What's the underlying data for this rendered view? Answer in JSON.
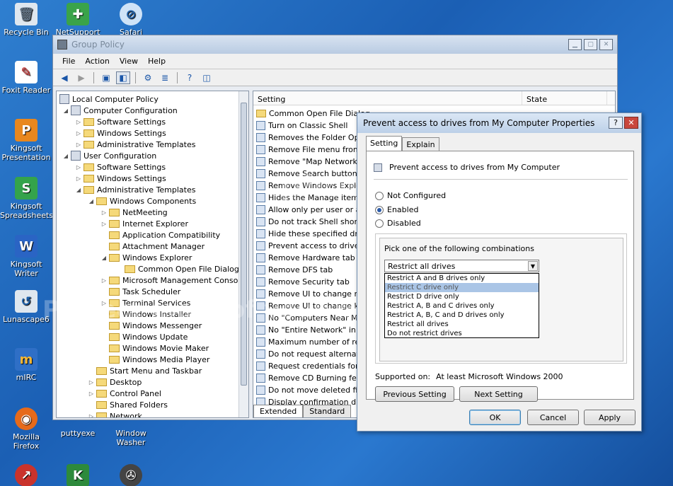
{
  "desktop": {
    "icons": [
      {
        "label": "Recycle Bin"
      },
      {
        "label": "NetSupport"
      },
      {
        "label": "Safari"
      },
      {
        "label": "Foxit Reader"
      },
      {
        "label": "Kingsoft Presentation"
      },
      {
        "label": "Kingsoft Spreadsheets"
      },
      {
        "label": "Kingsoft Writer"
      },
      {
        "label": "Lunascape6"
      },
      {
        "label": "mIRC"
      },
      {
        "label": "Mozilla Firefox"
      },
      {
        "label": "puttyexe"
      },
      {
        "label": "Window Washer"
      }
    ]
  },
  "window": {
    "title": "Group Policy",
    "menu": [
      "File",
      "Action",
      "View",
      "Help"
    ]
  },
  "tree": [
    "Local Computer Policy",
    "Computer Configuration",
    "Software Settings",
    "Windows Settings",
    "Administrative Templates",
    "User Configuration",
    "Software Settings",
    "Windows Settings",
    "Administrative Templates",
    "Windows Components",
    "NetMeeting",
    "Internet Explorer",
    "Application Compatibility",
    "Attachment Manager",
    "Windows Explorer",
    "Common Open File Dialog",
    "Microsoft Management Console",
    "Task Scheduler",
    "Terminal Services",
    "Windows Installer",
    "Windows Messenger",
    "Windows Update",
    "Windows Movie Maker",
    "Windows Media Player",
    "Start Menu and Taskbar",
    "Desktop",
    "Control Panel",
    "Shared Folders",
    "Network"
  ],
  "list": {
    "col_setting": "Setting",
    "col_state": "State",
    "rows": [
      "Common Open File Dialog",
      "Turn on Classic Shell",
      "Removes the Folder Optio",
      "Remove File menu from W",
      "Remove \"Map Network Dri",
      "Remove Search button fro",
      "Remove Windows Explore",
      "Hides the Manage item on",
      "Allow only per user or app",
      "Do not track Shell shortcu",
      "Hide these specified drives",
      "Prevent access to drives f",
      "Remove Hardware tab",
      "Remove DFS tab",
      "Remove Security tab",
      "Remove UI to change mer",
      "Remove UI to change key",
      "No \"Computers Near Me\" i",
      "No \"Entire Network\" in My",
      "Maximum number of recer",
      "Do not request alternate c",
      "Request credentials for ne",
      "Remove CD Burning featu",
      "Do not move deleted files",
      "Display confirmation dialog"
    ],
    "tabs": [
      "Extended",
      "Standard"
    ]
  },
  "dialog": {
    "title": "Prevent access to drives from My Computer Properties",
    "help": "?",
    "tabs": [
      "Setting",
      "Explain"
    ],
    "policy_name": "Prevent access to drives from My Computer",
    "options": [
      "Not Configured",
      "Enabled",
      "Disabled"
    ],
    "selected_option": "Enabled",
    "combo_label": "Pick one of the following combinations",
    "combo_value": "Restrict all drives",
    "dropdown": [
      "Restrict A and B drives only",
      "Restrict C drive only",
      "Restrict D drive only",
      "Restrict A, B and C drives only",
      "Restrict A, B, C and D drives only",
      "Restrict all drives",
      "Do not restrict drives"
    ],
    "highlighted": "Restrict C drive only",
    "supported_label": "Supported on:",
    "supported_value": "At least Microsoft Windows 2000",
    "prev_btn": "Previous Setting",
    "next_btn": "Next Setting",
    "ok": "OK",
    "cancel": "Cancel",
    "apply": "Apply"
  },
  "watermark": {
    "line1": "photobucket",
    "line2": "Protect more of your memories for less!"
  }
}
